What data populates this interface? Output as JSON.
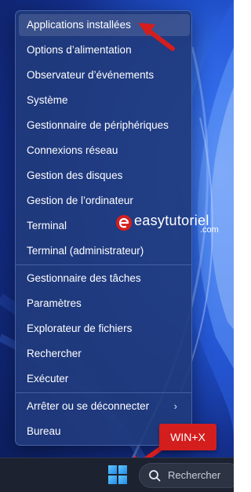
{
  "menu": {
    "items": [
      {
        "label": "Applications installées"
      },
      {
        "label": "Options d’alimentation"
      },
      {
        "label": "Observateur d’événements"
      },
      {
        "label": "Système"
      },
      {
        "label": "Gestionnaire de périphériques"
      },
      {
        "label": "Connexions réseau"
      },
      {
        "label": "Gestion des disques"
      },
      {
        "label": "Gestion de l’ordinateur"
      },
      {
        "label": "Terminal"
      },
      {
        "label": "Terminal (administrateur)"
      },
      {
        "label": "Gestionnaire des tâches"
      },
      {
        "label": "Paramètres"
      },
      {
        "label": "Explorateur de fichiers"
      },
      {
        "label": "Rechercher"
      },
      {
        "label": "Exécuter"
      },
      {
        "label": "Arrêter ou se déconnecter",
        "chevron": "›"
      },
      {
        "label": "Bureau"
      }
    ]
  },
  "watermark": {
    "text": "easytutoriel",
    "suffix": ".com"
  },
  "annotation": {
    "label": "WIN+X"
  },
  "taskbar": {
    "search_placeholder": "Rechercher"
  },
  "colors": {
    "accent": "#d41e1e",
    "menu_bg": "#203a7c",
    "taskbar_bg": "#1c2230"
  }
}
